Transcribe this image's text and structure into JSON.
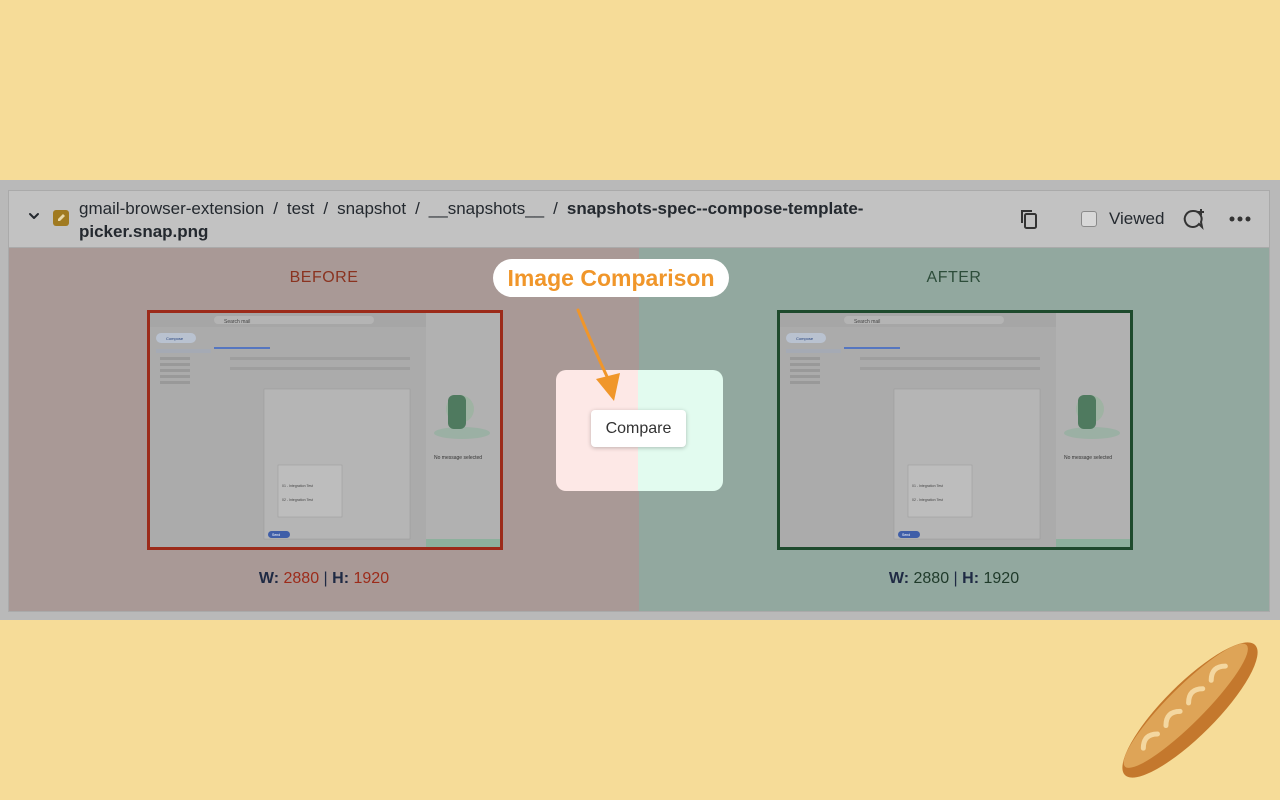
{
  "header": {
    "path_segments": [
      "gmail-browser-extension",
      "test",
      "snapshot",
      "__snapshots__"
    ],
    "separator": "/",
    "filename": "snapshots-spec--compose-template-picker.snap.png",
    "viewed_label": "Viewed"
  },
  "before": {
    "label": "BEFORE",
    "w_label": "W:",
    "w_value": "2880",
    "divider": "|",
    "h_label": "H:",
    "h_value": "1920"
  },
  "after": {
    "label": "AFTER",
    "w_label": "W:",
    "w_value": "2880",
    "divider": "|",
    "h_label": "H:",
    "h_value": "1920"
  },
  "callout": {
    "text": "Image Comparison"
  },
  "compare_button": {
    "label": "Compare"
  },
  "thumb": {
    "search_placeholder": "Search mail",
    "compose_label": "Compose",
    "no_message": "No message selected",
    "template_items": [
      "01 - Integration Test",
      "02 - Integration Test"
    ],
    "send_label": "Send"
  },
  "colors": {
    "before_accent": "#9c2b1a",
    "after_accent": "#1e4a2d",
    "callout_text": "#f0962a",
    "page_bg": "#f6dc98"
  }
}
